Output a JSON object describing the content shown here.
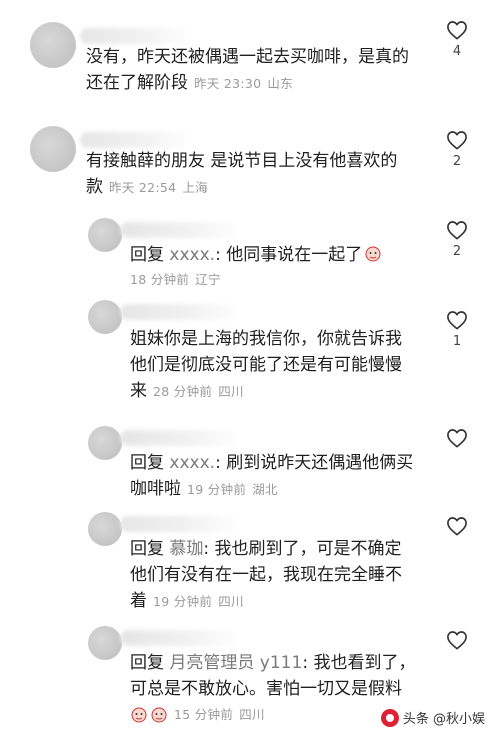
{
  "comments": [
    {
      "line1": "没有，昨天还被偶遇一起去买咖啡，是真的",
      "line2": "还在了解阶段",
      "time": "昨天 23:30",
      "location": "山东",
      "likes": "4"
    },
    {
      "line1": "有接触薛的朋友 是说节目上没有他喜欢的",
      "line2": "款",
      "time": "昨天 22:54",
      "location": "上海",
      "likes": "2"
    },
    {
      "prefix": "回复",
      "name": "xxxx.",
      "text": ": 他同事说在一起了",
      "time": "18 分钟前",
      "location": "辽宁",
      "likes": "2"
    },
    {
      "line1": "姐妹你是上海的我信你，你就告诉我",
      "line2": "他们是彻底没可能了还是有可能慢慢",
      "line3": "来",
      "time": "28 分钟前",
      "location": "四川",
      "likes": "1"
    },
    {
      "prefix": "回复",
      "name": "xxxx.",
      "text": ": 刷到说昨天还偶遇他俩买",
      "line2": "咖啡啦",
      "time": "19 分钟前",
      "location": "湖北",
      "likes": ""
    },
    {
      "prefix": "回复",
      "name": "慕珈",
      "text": ": 我也刷到了，可是不确定",
      "line2": "他们有没有在一起，我现在完全睡不",
      "line3": "着",
      "time": "19 分钟前",
      "location": "四川",
      "likes": ""
    },
    {
      "prefix": "回复",
      "name": "月亮管理员 y111",
      "text": ": 我也看到了，",
      "line2": "可总是不敢放心。害怕一切又是假料",
      "time": "15 分钟前",
      "location": "四川",
      "likes": ""
    }
  ],
  "watermark": {
    "text": "头条 @秋小娱"
  }
}
